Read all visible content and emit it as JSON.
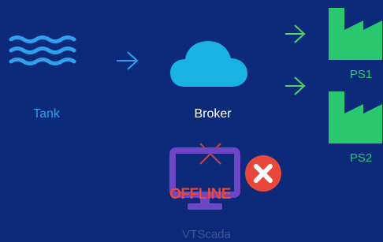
{
  "diagram": {
    "nodes": {
      "tank": {
        "label": "Tank",
        "icon": "waves-icon",
        "color": "#2f9ff0"
      },
      "broker": {
        "label": "Broker",
        "icon": "cloud-icon",
        "color": "#ffffff"
      },
      "ps1": {
        "label": "PS1",
        "icon": "factory-icon",
        "color": "#29c86f"
      },
      "ps2": {
        "label": "PS2",
        "icon": "factory-icon",
        "color": "#29c86f"
      },
      "scada": {
        "label": "VTScada",
        "icon": "monitor-icon",
        "status": "OFFLINE",
        "status_color": "#e8473c",
        "label_color": "#41528f"
      }
    },
    "colors": {
      "background": "#0c2a79",
      "arrow_blue": "#2f9ff0",
      "arrow_green": "#4fd46c",
      "cloud": "#1ab2e3",
      "monitor": "#6d46c8",
      "error": "#e8473c"
    }
  }
}
